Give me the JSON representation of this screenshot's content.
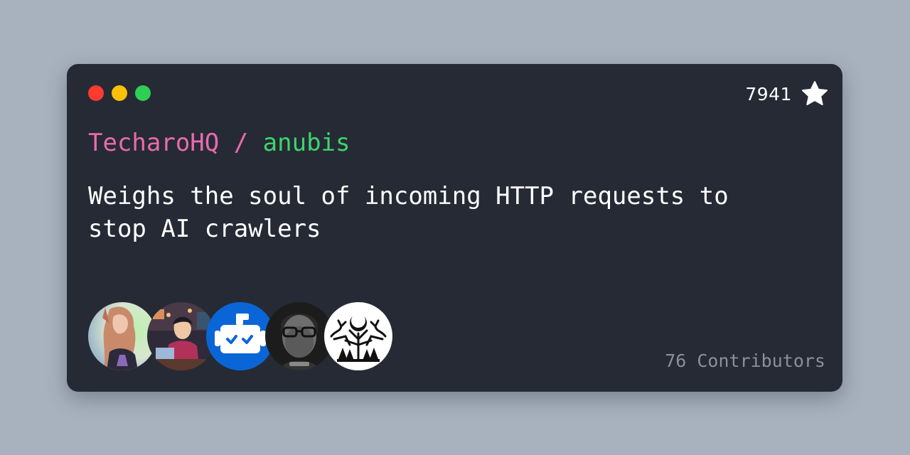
{
  "window": {
    "controls": [
      "close",
      "minimize",
      "maximize"
    ],
    "colors": {
      "close": "#ff3b30",
      "minimize": "#ffc00a",
      "maximize": "#2fce55"
    }
  },
  "repo": {
    "owner": "TecharoHQ",
    "separator": " / ",
    "name": "anubis",
    "owner_color": "#e96bb0",
    "name_color": "#3fd46c"
  },
  "stars": {
    "count": "7941",
    "icon": "star-icon"
  },
  "description": "Weighs the soul of incoming HTTP requests to stop AI crawlers",
  "contributors": {
    "label": "76 Contributors",
    "avatars": [
      "anime-character-avatar",
      "anime-developer-avatar",
      "bot-avatar",
      "person-glasses-avatar",
      "forest-moon-logo-avatar"
    ]
  }
}
